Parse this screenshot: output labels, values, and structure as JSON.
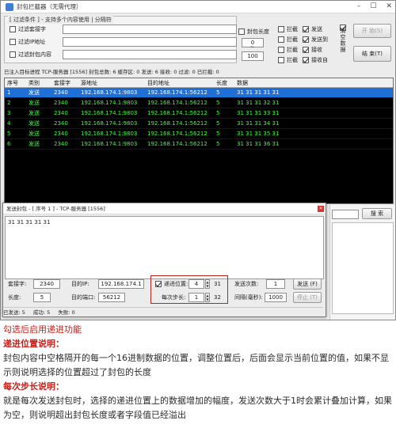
{
  "window": {
    "title": "封包拦截器（无需代理）",
    "min": "–",
    "max": "☐",
    "close": "✕"
  },
  "filter": {
    "legend": "[ 过滤条件 ] - 支持多个内容使用 | 分隔符",
    "opt_keyword": "过滤套接字",
    "opt_ip": "过滤IP地址",
    "opt_content": "过滤封包内容",
    "len_label": "封包长度",
    "len_min": "0",
    "len_sep": "~",
    "len_max": "100"
  },
  "options": {
    "intercept1": "拦截",
    "send": "发送",
    "intercept2": "拦截",
    "sendto": "发送到",
    "intercept3": "拦截",
    "recv": "接收",
    "intercept4": "拦截",
    "recvfrom": "接收自",
    "clear_label": "清空数据",
    "start_btn": "开 始(S)",
    "stop_btn": "结 束(T)"
  },
  "status_top": "已注入目标进程 TCP-服务器 [1556]  封包总数: 6  缓存区: 0  发送: 6  接收: 0  过滤: 0  已拦截: 0",
  "table": {
    "headers": [
      "序号",
      "类别",
      "套接字",
      "源地址",
      "目的地址",
      "长度",
      "数据"
    ],
    "rows": [
      [
        "1",
        "发送",
        "2340",
        "192.168.174.1:9803",
        "192.168.174.1:56212",
        "5",
        "31 31 31 31 31"
      ],
      [
        "2",
        "发送",
        "2340",
        "192.168.174.1:9803",
        "192.168.174.1:56212",
        "5",
        "31 31 31 32 31"
      ],
      [
        "3",
        "发送",
        "2340",
        "192.168.174.1:9803",
        "192.168.174.1:56212",
        "5",
        "31 31 31 33 31"
      ],
      [
        "4",
        "发送",
        "2340",
        "192.168.174.1:9803",
        "192.168.174.1:56212",
        "5",
        "31 31 31 34 31"
      ],
      [
        "5",
        "发送",
        "2340",
        "192.168.174.1:9803",
        "192.168.174.1:56212",
        "5",
        "31 31 31 35 31"
      ],
      [
        "6",
        "发送",
        "2340",
        "192.168.174.1:9803",
        "192.168.174.1:56212",
        "5",
        "31 31 31 36 31"
      ]
    ]
  },
  "side": {
    "search_btn": "搜 索"
  },
  "dialog": {
    "title": "发送封包 - [ 序号 1 ] - TCP-服务器 [1556]",
    "payload": "31 31 31 31 31",
    "socket_label": "套接字:",
    "socket_val": "2340",
    "len_label": "长度:",
    "len_val": "5",
    "dest_ip_label": "目的IP:",
    "dest_ip_val": "192.168.174.1",
    "dest_port_label": "目的端口:",
    "dest_port_val": "56212",
    "inc_pos_label": "递进位置:",
    "inc_pos_val": "4",
    "inc_pos_max": "31",
    "step_label": "每次步长:",
    "step_val": "1",
    "step_max": "32",
    "send_count_label": "发送次数:",
    "send_count_val": "1",
    "interval_label": "间隔(毫秒):",
    "interval_val": "1000",
    "send_btn": "发送 (F)",
    "stop_btn": "停止 (T)",
    "status_sent": "已发送: 5",
    "status_ok": "成功: 5",
    "status_fail": "失败: 0"
  },
  "notes": {
    "line1": "勾选后启用递进功能",
    "h1": "递进位置说明：",
    "p1": "封包内容中空格隔开的每一个16进制数据的位置，调整位置后，后面会显示当前位置的值，如果不显示则说明选择的位置超过了封包的长度",
    "h2": "每次步长说明：",
    "p2": "就是每次发送封包时，选择的递进位置上的数据增加的幅度，发送次数大于1时会累计叠加计算，如果为空，则说明超出封包长度或者字段值已经溢出"
  },
  "colors": {
    "selected_row": "#1e6fd6",
    "table_text": "#3bff3b",
    "highlight": "#c4201b"
  }
}
